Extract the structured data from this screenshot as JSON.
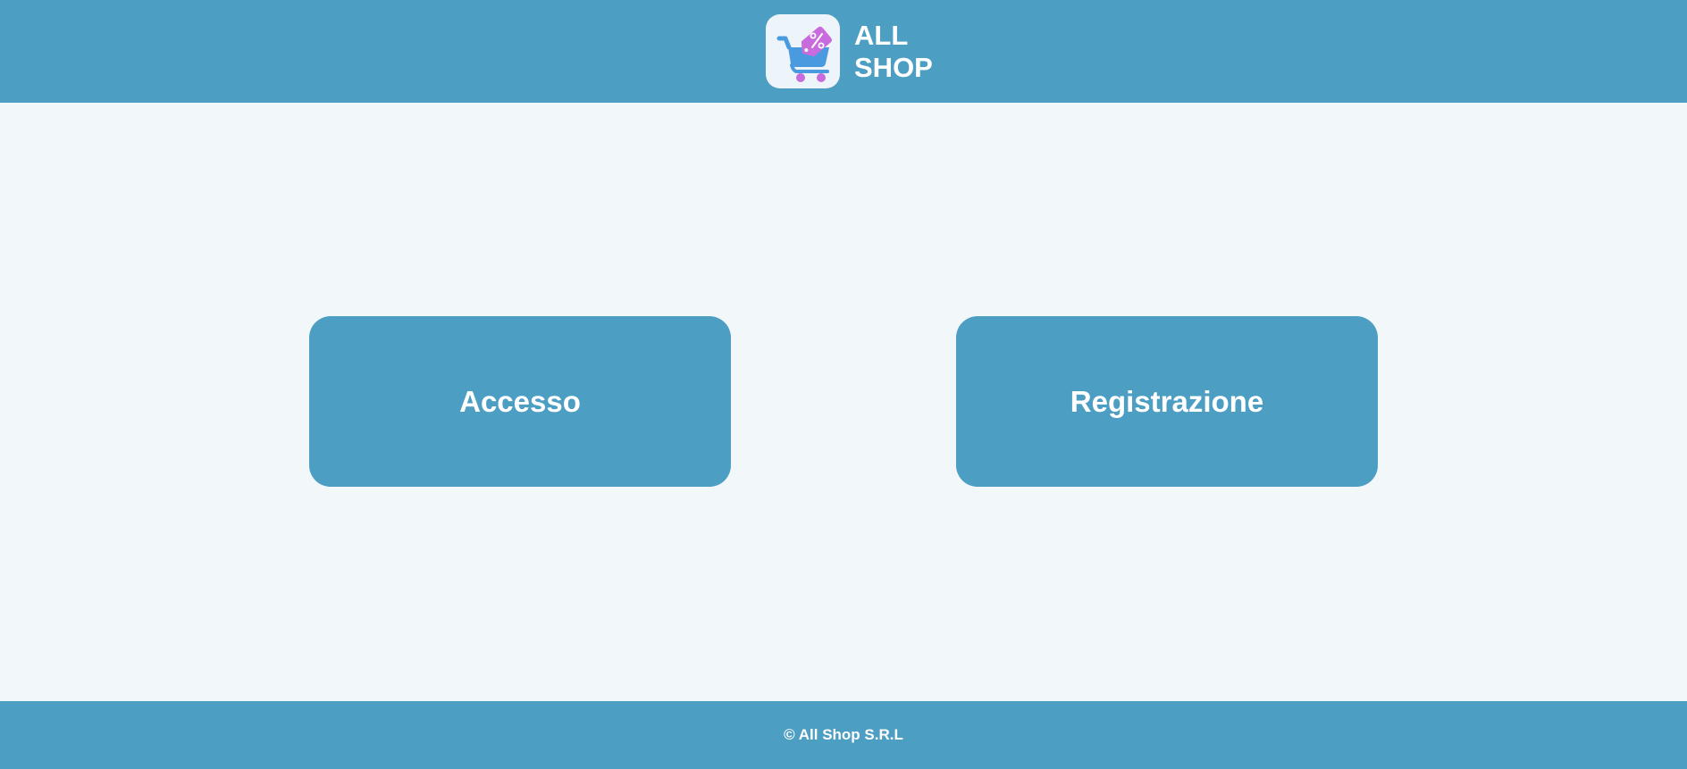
{
  "header": {
    "logo_icon": "shopping-cart-discount-tag-icon",
    "brand_line1": "ALL",
    "brand_line2": "SHOP"
  },
  "main": {
    "login_label": "Accesso",
    "register_label": "Registrazione"
  },
  "footer": {
    "copyright": "© All Shop S.R.L"
  },
  "colors": {
    "primary": "#4d9ec3",
    "background": "#f2f7fa",
    "cart_blue": "#4a9ae0",
    "tag_purple": "#c86bdc",
    "text_on_primary": "#ffffff"
  }
}
